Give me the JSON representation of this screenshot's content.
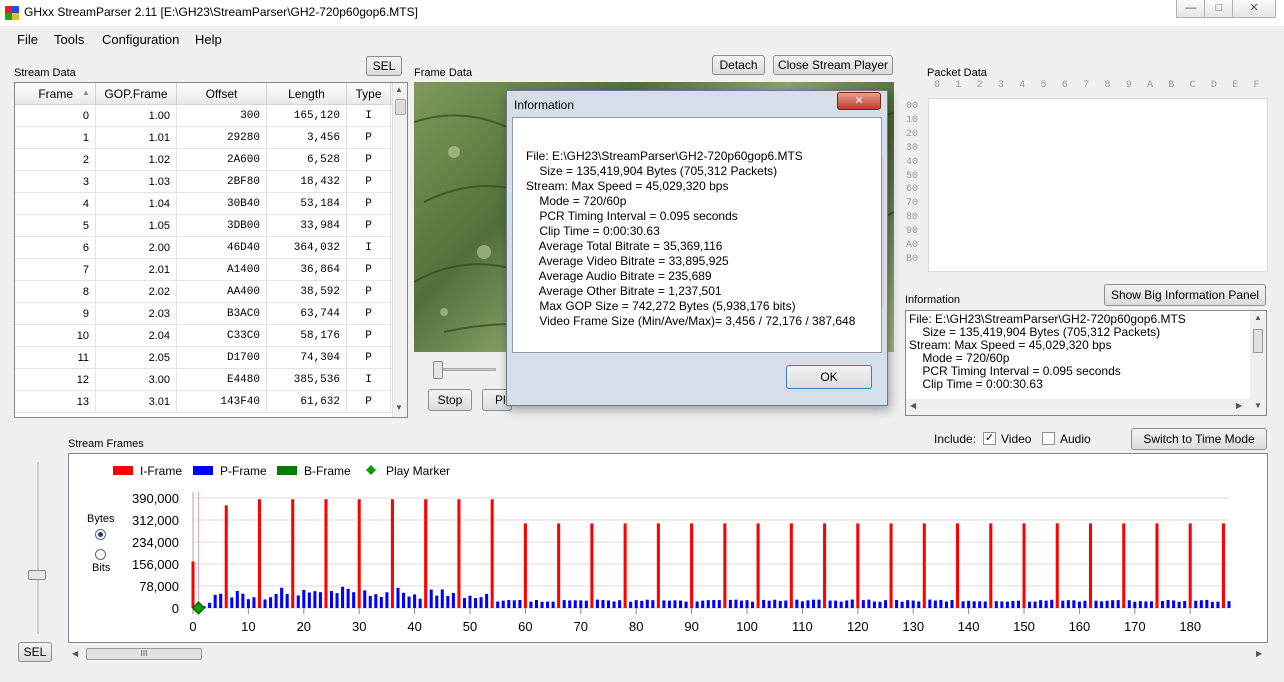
{
  "window": {
    "title": "GHxx StreamParser 2.11 [E:\\GH23\\StreamParser\\GH2-720p60gop6.MTS]",
    "minimize": "—",
    "maximize": "□",
    "close": "✕"
  },
  "menu": [
    "File",
    "Tools",
    "Configuration",
    "Help"
  ],
  "stream_data": {
    "label": "Stream Data",
    "sel_button": "SEL",
    "columns": [
      "Frame",
      "GOP.Frame",
      "Offset",
      "Length",
      "Type"
    ],
    "rows": [
      [
        "0",
        "1.00",
        "300",
        "165,120",
        "I"
      ],
      [
        "1",
        "1.01",
        "29280",
        "3,456",
        "P"
      ],
      [
        "2",
        "1.02",
        "2A600",
        "6,528",
        "P"
      ],
      [
        "3",
        "1.03",
        "2BF80",
        "18,432",
        "P"
      ],
      [
        "4",
        "1.04",
        "30B40",
        "53,184",
        "P"
      ],
      [
        "5",
        "1.05",
        "3DB00",
        "33,984",
        "P"
      ],
      [
        "6",
        "2.00",
        "46D40",
        "364,032",
        "I"
      ],
      [
        "7",
        "2.01",
        "A1400",
        "36,864",
        "P"
      ],
      [
        "8",
        "2.02",
        "AA400",
        "38,592",
        "P"
      ],
      [
        "9",
        "2.03",
        "B3AC0",
        "63,744",
        "P"
      ],
      [
        "10",
        "2.04",
        "C33C0",
        "58,176",
        "P"
      ],
      [
        "11",
        "2.05",
        "D1700",
        "74,304",
        "P"
      ],
      [
        "12",
        "3.00",
        "E4480",
        "385,536",
        "I"
      ],
      [
        "13",
        "3.01",
        "143F40",
        "61,632",
        "P"
      ]
    ]
  },
  "frame_data": {
    "label": "Frame Data",
    "detach_button": "Detach",
    "close_player_button": "Close Stream Player",
    "stop_button": "Stop",
    "play_button_partial": "Pl"
  },
  "packet_data": {
    "label": "Packet Data",
    "columns": [
      "0",
      "1",
      "2",
      "3",
      "4",
      "5",
      "6",
      "7",
      "8",
      "9",
      "A",
      "B",
      "C",
      "D",
      "E",
      "F"
    ],
    "rows": [
      "00",
      "10",
      "20",
      "30",
      "40",
      "50",
      "60",
      "70",
      "80",
      "90",
      "A0",
      "B0"
    ]
  },
  "information": {
    "label": "Information",
    "big_panel_button": "Show Big Information Panel",
    "lines": [
      "File: E:\\GH23\\StreamParser\\GH2-720p60gop6.MTS",
      "    Size = 135,419,904 Bytes (705,312 Packets)",
      "Stream: Max Speed = 45,029,320 bps",
      "    Mode = 720/60p",
      "    PCR Timing Interval = 0.095 seconds",
      "    Clip Time = 0:00:30.63"
    ]
  },
  "dialog": {
    "title": "Information",
    "close": "✕",
    "ok_button": "OK",
    "lines": [
      "File: E:\\GH23\\StreamParser\\GH2-720p60gop6.MTS",
      "    Size = 135,419,904 Bytes (705,312 Packets)",
      "Stream: Max Speed = 45,029,320 bps",
      "    Mode = 720/60p",
      "    PCR Timing Interval = 0.095 seconds",
      "    Clip Time = 0:00:30.63",
      "    Average Total Bitrate = 35,369,116",
      "    Average Video Bitrate = 33,895,925",
      "    Average Audio Bitrate = 235,689",
      "    Average Other Bitrate = 1,237,501",
      "    Max GOP Size = 742,272 Bytes (5,938,176 bits)",
      "    Video Frame Size (Min/Ave/Max)= 3,456 / 72,176 / 387,648"
    ]
  },
  "stream_frames": {
    "label": "Stream Frames",
    "include_label": "Include:",
    "video_label": "Video",
    "audio_label": "Audio",
    "video_checked": "✓",
    "time_mode_button": "Switch to Time Mode",
    "sel_button": "SEL",
    "bytes_label": "Bytes",
    "bits_label": "Bits",
    "scroll_grip": "III"
  },
  "chart_data": {
    "type": "bar",
    "legend": [
      "I-Frame",
      "P-Frame",
      "B-Frame",
      "Play Marker"
    ],
    "colors": {
      "I": "#ff0000",
      "P": "#0000ff",
      "B": "#008000",
      "marker": "#00a000"
    },
    "yticks": [
      "390,000",
      "312,000",
      "234,000",
      "156,000",
      "78,000",
      "0"
    ],
    "ylim": [
      0,
      390000
    ],
    "xticks": [
      "0",
      "10",
      "20",
      "30",
      "40",
      "50",
      "60",
      "70",
      "80",
      "90",
      "100",
      "110",
      "120",
      "130",
      "140",
      "150",
      "160",
      "170",
      "180"
    ],
    "xlim": [
      0,
      187
    ],
    "i_frame_values": {
      "early": [
        165120,
        364032,
        385536,
        385536,
        385536,
        385536,
        385536,
        385536,
        385536,
        385536
      ],
      "late": 300000
    },
    "p_frame_values": {
      "early_range": [
        30000,
        75000
      ],
      "late_range": [
        22000,
        30000
      ]
    },
    "play_marker_frame": 1
  }
}
